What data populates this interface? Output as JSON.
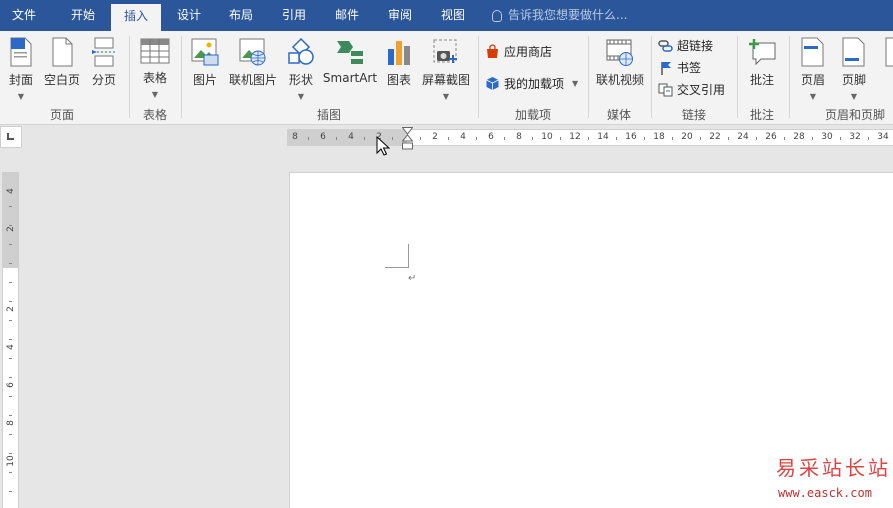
{
  "tabs": [
    {
      "label": "文件",
      "active": false
    },
    {
      "label": "开始",
      "active": false
    },
    {
      "label": "插入",
      "active": true
    },
    {
      "label": "设计",
      "active": false
    },
    {
      "label": "布局",
      "active": false
    },
    {
      "label": "引用",
      "active": false
    },
    {
      "label": "邮件",
      "active": false
    },
    {
      "label": "审阅",
      "active": false
    },
    {
      "label": "视图",
      "active": false
    }
  ],
  "tell_me": {
    "placeholder": "告诉我您想要做什么..."
  },
  "groups": {
    "pages": {
      "label": "页面",
      "buttons": {
        "cover": "封面",
        "blank": "空白页",
        "break": "分页"
      }
    },
    "tables": {
      "label": "表格",
      "buttons": {
        "table": "表格"
      }
    },
    "illustrations": {
      "label": "插图",
      "buttons": {
        "picture": "图片",
        "online_picture": "联机图片",
        "shapes": "形状",
        "smartart": "SmartArt",
        "chart": "图表",
        "screenshot": "屏幕截图"
      }
    },
    "addins": {
      "label": "加载项",
      "buttons": {
        "store": "应用商店",
        "my_addins": "我的加载项"
      }
    },
    "media": {
      "label": "媒体",
      "buttons": {
        "online_video": "联机视频"
      }
    },
    "links": {
      "label": "链接",
      "buttons": {
        "hyperlink": "超链接",
        "bookmark": "书签",
        "cross_ref": "交叉引用"
      }
    },
    "comments": {
      "label": "批注",
      "buttons": {
        "comment": "批注"
      }
    },
    "header_footer": {
      "label": "页眉和页脚",
      "buttons": {
        "header": "页眉",
        "footer": "页脚"
      }
    }
  },
  "ruler": {
    "h_left": [
      "8",
      "6",
      "4",
      "2"
    ],
    "h_right": [
      "2",
      "4",
      "6",
      "8",
      "10",
      "12",
      "14",
      "16",
      "18",
      "20",
      "22",
      "24",
      "26",
      "28",
      "30",
      "32",
      "34"
    ],
    "v_top": [
      "4",
      "2"
    ],
    "v_body": [
      "2",
      "4",
      "6",
      "8",
      "10"
    ]
  },
  "document": {
    "paragraph_mark": "↵"
  },
  "watermark": {
    "site_name": "易采站长站",
    "url": "www.easck.com"
  },
  "colors": {
    "ribbon_blue": "#2b579a",
    "ribbon_bg": "#f3f3f3"
  }
}
